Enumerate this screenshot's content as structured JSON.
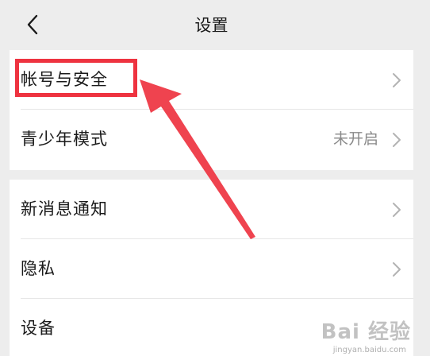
{
  "header": {
    "title": "设置"
  },
  "groups": [
    {
      "items": [
        {
          "label": "帐号与安全",
          "value": ""
        },
        {
          "label": "青少年模式",
          "value": "未开启"
        }
      ]
    },
    {
      "items": [
        {
          "label": "新消息通知",
          "value": ""
        },
        {
          "label": "隐私",
          "value": ""
        },
        {
          "label": "设备",
          "value": ""
        }
      ]
    }
  ],
  "annotation": {
    "highlight_color": "#ee3340"
  },
  "watermark": {
    "brand": "Bai 经验",
    "url": "jingyan.baidu.com"
  },
  "icons": {
    "back": "chevron-left-icon",
    "row": "chevron-right-icon"
  }
}
